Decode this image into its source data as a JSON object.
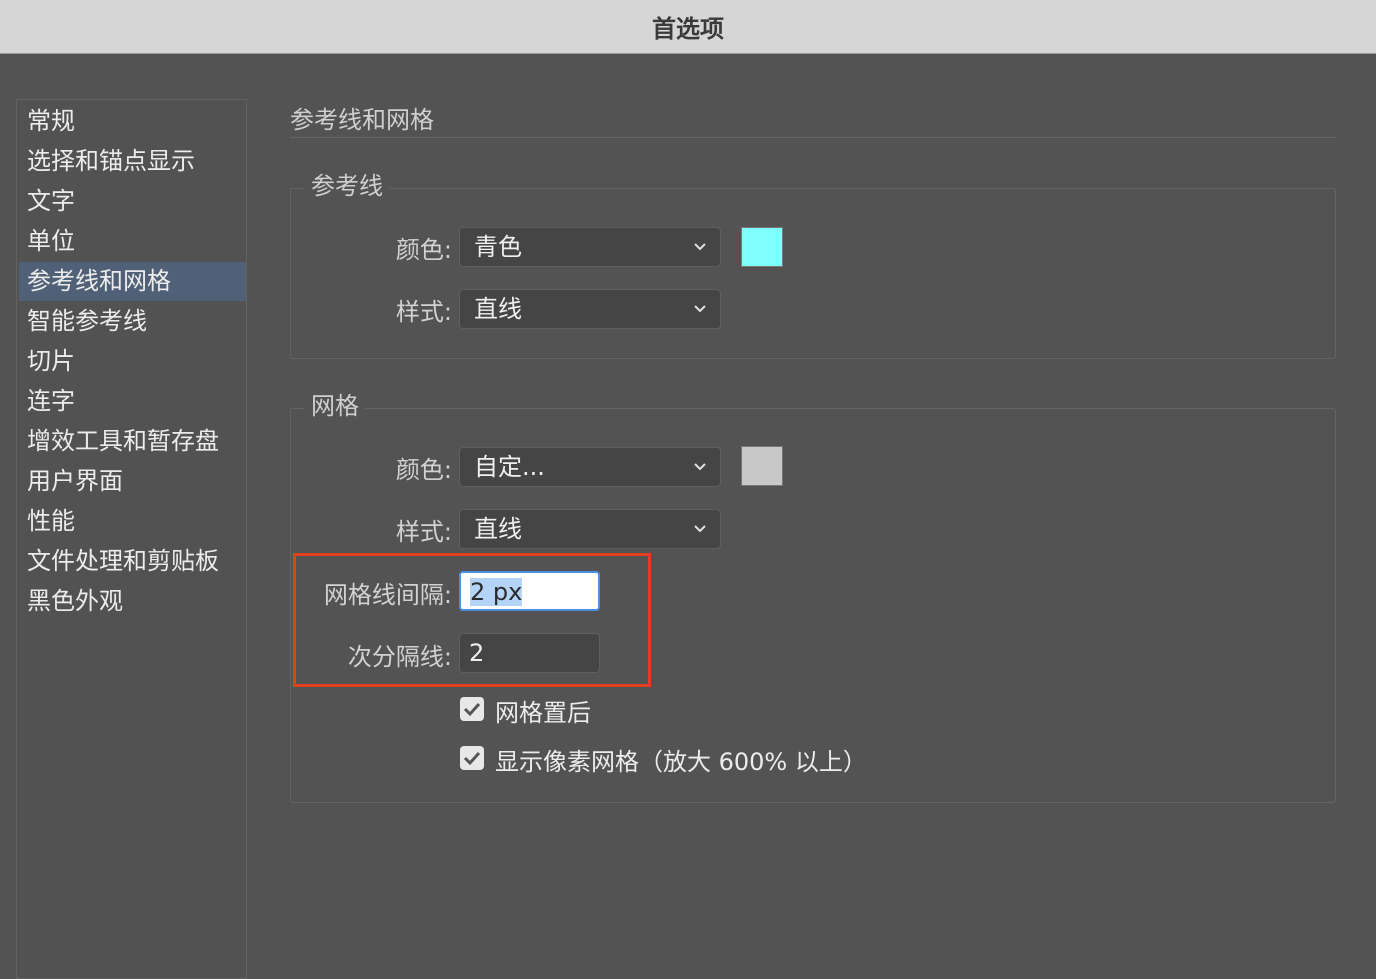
{
  "window": {
    "title": "首选项"
  },
  "sidebar": {
    "items": [
      {
        "label": "常规"
      },
      {
        "label": "选择和锚点显示"
      },
      {
        "label": "文字"
      },
      {
        "label": "单位"
      },
      {
        "label": "参考线和网格",
        "active": true
      },
      {
        "label": "智能参考线"
      },
      {
        "label": "切片"
      },
      {
        "label": "连字"
      },
      {
        "label": "增效工具和暂存盘"
      },
      {
        "label": "用户界面"
      },
      {
        "label": "性能"
      },
      {
        "label": "文件处理和剪贴板"
      },
      {
        "label": "黑色外观"
      }
    ]
  },
  "main": {
    "title": "参考线和网格",
    "guides": {
      "legend": "参考线",
      "color_label": "颜色:",
      "color_value": "青色",
      "color_swatch": "#80ffff",
      "style_label": "样式:",
      "style_value": "直线"
    },
    "grid": {
      "legend": "网格",
      "color_label": "颜色:",
      "color_value": "自定...",
      "color_swatch": "#c8c8c8",
      "style_label": "样式:",
      "style_value": "直线",
      "gridline_label": "网格线间隔:",
      "gridline_value": "2 px",
      "subdivisions_label": "次分隔线:",
      "subdivisions_value": "2",
      "grids_in_back_label": "网格置后",
      "grids_in_back_checked": true,
      "pixel_grid_label": "显示像素网格（放大 600% 以上）",
      "pixel_grid_checked": true
    }
  },
  "colors": {
    "active_item": "#506177",
    "highlight": "#e0401c",
    "focus": "#4a90e2"
  }
}
